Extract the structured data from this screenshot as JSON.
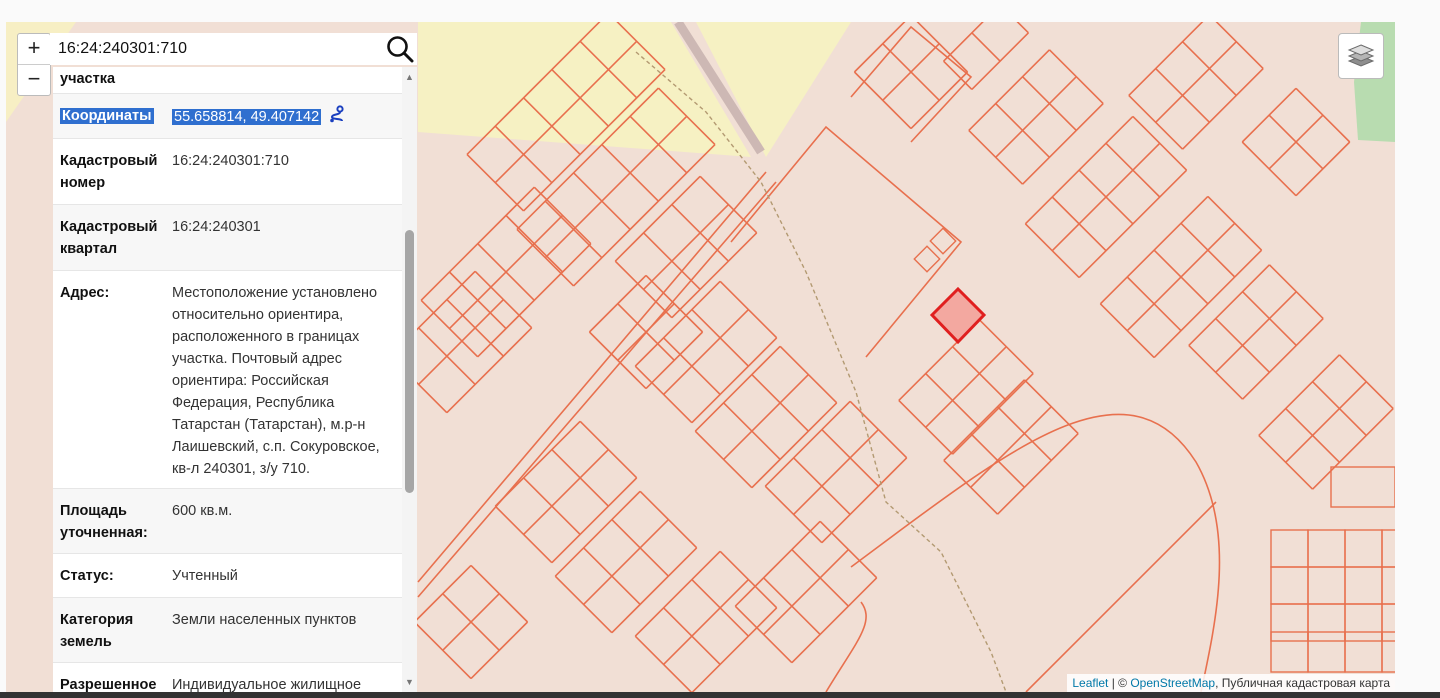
{
  "search": {
    "value": "16:24:240301:710"
  },
  "zoom": {
    "in_label": "+",
    "out_label": "−"
  },
  "parcel": {
    "rows": [
      {
        "label": "участка",
        "value": ""
      },
      {
        "label": "Координаты",
        "value": "55.658814, 49.407142"
      },
      {
        "label": "Кадастровый номер",
        "value": "16:24:240301:710"
      },
      {
        "label": "Кадастровый квартал",
        "value": "16:24:240301"
      },
      {
        "label": "Адрес:",
        "value": "Местоположение установлено относительно ориентира, расположенного в границах участка. Почтовый адрес ориентира: Российская Федерация, Республика Татарстан (Татарстан), м.р-н Лаишевский, с.п. Сокуровское, кв-л 240301, з/у 710."
      },
      {
        "label": "Площадь уточненная:",
        "value": "600 кв.м."
      },
      {
        "label": "Статус:",
        "value": "Учтенный"
      },
      {
        "label": "Категория земель",
        "value": "Земли населенных пунктов"
      },
      {
        "label": "Разрешенное",
        "value": "Индивидуальное жилищное"
      }
    ]
  },
  "attribution": {
    "leaflet": "Leaflet",
    "sep": " | © ",
    "osm": "OpenStreetMap",
    "rest": ", Публичная кадастровая карта"
  },
  "icons": {
    "search": "search-icon",
    "layers": "layers-icon",
    "route": "route-icon",
    "scroll_up": "chevron-up-icon",
    "scroll_down": "chevron-down-icon"
  },
  "colors": {
    "parcel_line": "#e8704e",
    "map_background": "#f1dfd5",
    "selected_fill": "#f3a8a0",
    "selected_stroke": "#e01f1f",
    "selection_highlight": "#2f6fcf"
  }
}
